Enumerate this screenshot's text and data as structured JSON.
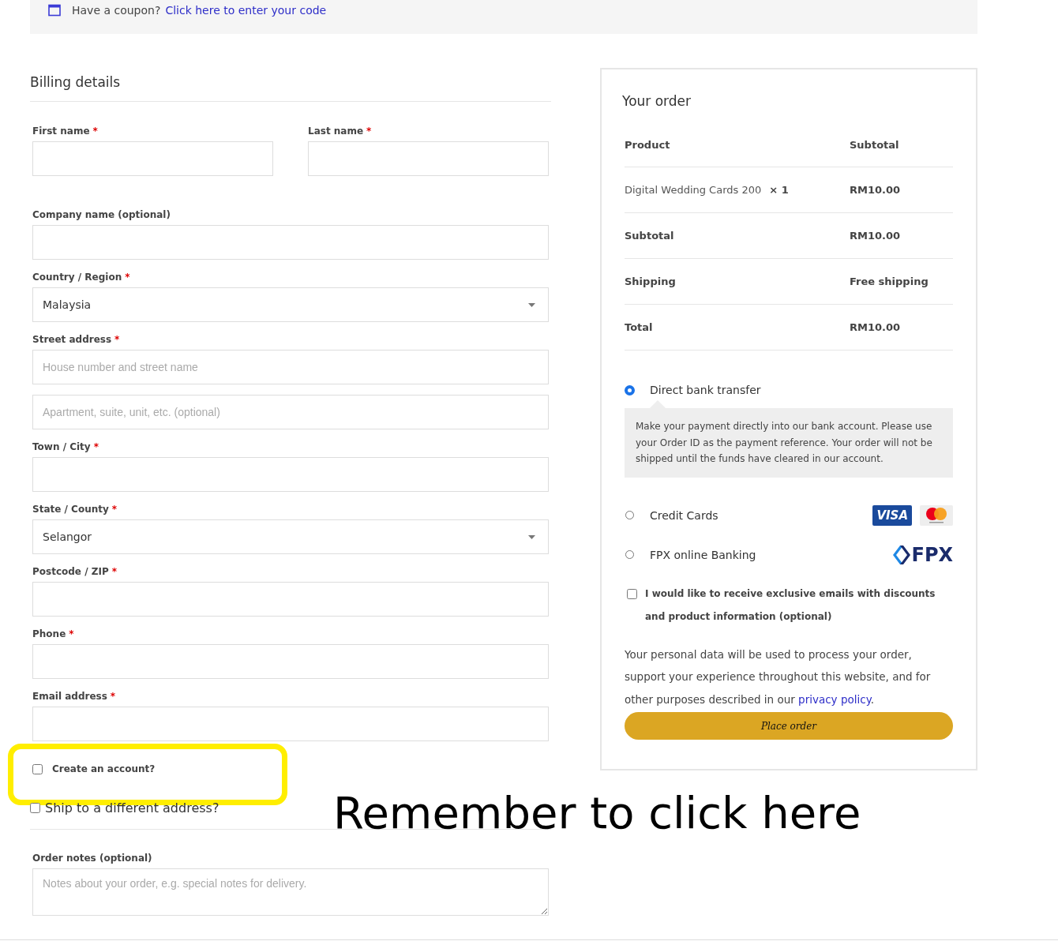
{
  "coupon": {
    "text": "Have a coupon?",
    "link": "Click here to enter your code"
  },
  "billing": {
    "title": "Billing details",
    "rows": [
      [
        {
          "label": "First name",
          "required_mark": "*",
          "kind": "input"
        },
        {
          "label": "Last name",
          "required_mark": "*",
          "kind": "input"
        }
      ],
      [
        {
          "label": "Company name (optional)",
          "kind": "input"
        }
      ],
      [
        {
          "label": "Country / Region",
          "required_mark": "*",
          "kind": "select",
          "value": "Malaysia"
        }
      ],
      [
        {
          "label": "Street address",
          "required_mark": "*",
          "kind": "input",
          "placeholder": "House number and street name"
        }
      ],
      [
        {
          "kind": "input",
          "placeholder": "Apartment, suite, unit, etc. (optional)"
        }
      ],
      [
        {
          "label": "Town / City",
          "required_mark": "*",
          "kind": "input"
        }
      ],
      [
        {
          "label": "State / County",
          "required_mark": "*",
          "kind": "select",
          "value": "Selangor"
        }
      ],
      [
        {
          "label": "Postcode / ZIP",
          "required_mark": "*",
          "kind": "input"
        }
      ],
      [
        {
          "label": "Phone",
          "required_mark": "*",
          "kind": "input"
        }
      ],
      [
        {
          "label": "Email address",
          "required_mark": "*",
          "kind": "input"
        }
      ]
    ]
  },
  "create_account": {
    "label": "Create an account?",
    "checked": false,
    "highlighted": true
  },
  "ship_different": {
    "label": "Ship to a different address?",
    "checked": false
  },
  "order_notes": {
    "label": "Order notes (optional)",
    "placeholder": "Notes about your order, e.g. special notes for delivery."
  },
  "annotation": {
    "text": "Remember to click here"
  },
  "order": {
    "title": "Your order",
    "columns": [
      "Product",
      "Subtotal"
    ],
    "items": [
      {
        "name": "Digital Wedding Cards 200",
        "qty": "× 1",
        "price": "RM10.00"
      }
    ],
    "totals": [
      {
        "label": "Subtotal",
        "value": "RM10.00"
      },
      {
        "label": "Shipping",
        "value": "Free shipping"
      },
      {
        "label": "Total",
        "value": "RM10.00"
      }
    ]
  },
  "payments": [
    {
      "label": "Direct bank transfer",
      "selected": true,
      "description": "Make your payment directly into our bank account. Please use your Order ID as the payment reference. Your order will not be shipped until the funds have cleared in our account."
    },
    {
      "label": "Credit Cards",
      "selected": false,
      "logos": [
        {
          "kind": "visa",
          "text": "VISA"
        },
        {
          "kind": "mastercard"
        }
      ]
    },
    {
      "label": "FPX online Banking",
      "selected": false,
      "logos": [
        {
          "kind": "fpx",
          "text": "FPX"
        }
      ]
    }
  ],
  "newsletter": {
    "label": "I would like to receive exclusive emails with discounts and product information (optional)",
    "checked": false
  },
  "privacy": {
    "text": "Your personal data will be used to process your order, support your experience throughout this website, and for other purposes described in our ",
    "link": "privacy policy",
    "end": "."
  },
  "place_order": "Place order"
}
